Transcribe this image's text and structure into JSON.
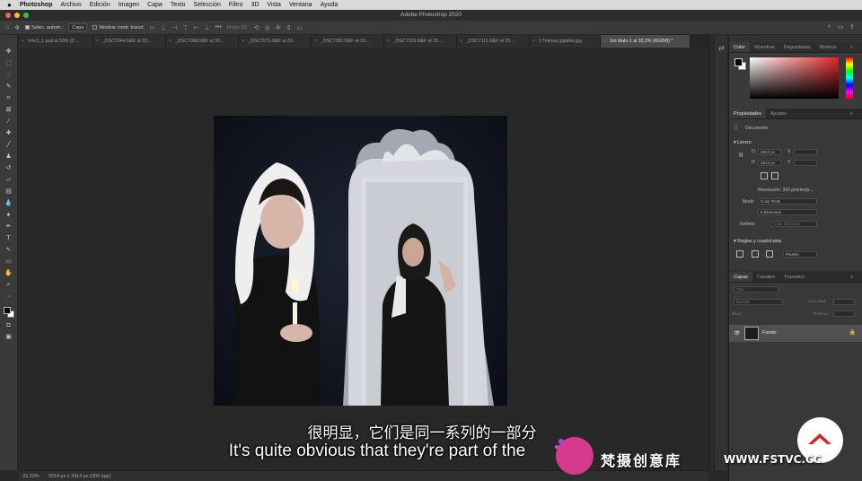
{
  "menubar": {
    "apple": "",
    "app": "Photoshop",
    "items": [
      "Archivo",
      "Edición",
      "Imagen",
      "Capa",
      "Texto",
      "Selección",
      "Filtro",
      "3D",
      "Vista",
      "Ventana",
      "Ayuda"
    ]
  },
  "window": {
    "title": "Adobe Photoshop 2020"
  },
  "options": {
    "auto_select_label": "Selec. autom.:",
    "auto_select_value": "Capa",
    "transform_label": "Mostrar contr. transf.",
    "mode_3d_label": "Modo 3D:"
  },
  "tabs": [
    "U4L3_1.psd al 50% (C...",
    "_DSC7044.NEF al 33...",
    "_DSC7008.NEF al 33...",
    "_DSC7075.NEF al 33...",
    "_DSC7081.NEF al 33...",
    "_DSC7109.NEF al 33...",
    "_DSC7111.NEF al 33...",
    "1 Textura gigante.jpg",
    "Sin título-1 al 33,3% (RGB/8) *"
  ],
  "status": {
    "zoom": "33,33%",
    "doc_info": "3914 px x 3914 px (300 ppp)"
  },
  "color_panel": {
    "tabs": [
      "Color",
      "Muestras",
      "Degradados",
      "Motivos"
    ],
    "active": "Color"
  },
  "properties": {
    "tabs": [
      "Propiedades",
      "Ajustes"
    ],
    "document_label": "Documento",
    "canvas_label": "Lienzo",
    "width_label": "O",
    "width_value": "3914 px",
    "height_label": "H",
    "height_value": "3914 px",
    "x_label": "X",
    "y_label": "Y",
    "resolution": "Resolución: 300 píxeles/p...",
    "mode_label": "Modo",
    "mode_value": "Color RGB",
    "depth_value": "8 bits/canal",
    "fill_label": "Relleno",
    "fill_value": "Color de fondo",
    "rulers_label": "Reglas y cuadrículas",
    "rulers_unit": "Píxeles"
  },
  "layers": {
    "tabs": [
      "Capas",
      "Canales",
      "Trazados"
    ],
    "kind_placeholder": "Tipo",
    "blend_mode": "Normal",
    "opacity_label": "Opacidad:",
    "lock_label": "Bloq.:",
    "fill_label": "Relleno:",
    "layer_name": "Fondo"
  },
  "subtitles": {
    "chinese": "很明显，它们是同一系列的一部分",
    "english": "It's quite obvious that they're part of the"
  },
  "watermark": {
    "brand": "梵摄创意库",
    "url": "WWW.FSTVC.CC",
    "logo": "FS"
  },
  "colors": {
    "accent_red": "#e0252b",
    "panel_bg": "#383838",
    "canvas_bg": "#282828",
    "layer_selected": "#505050"
  }
}
